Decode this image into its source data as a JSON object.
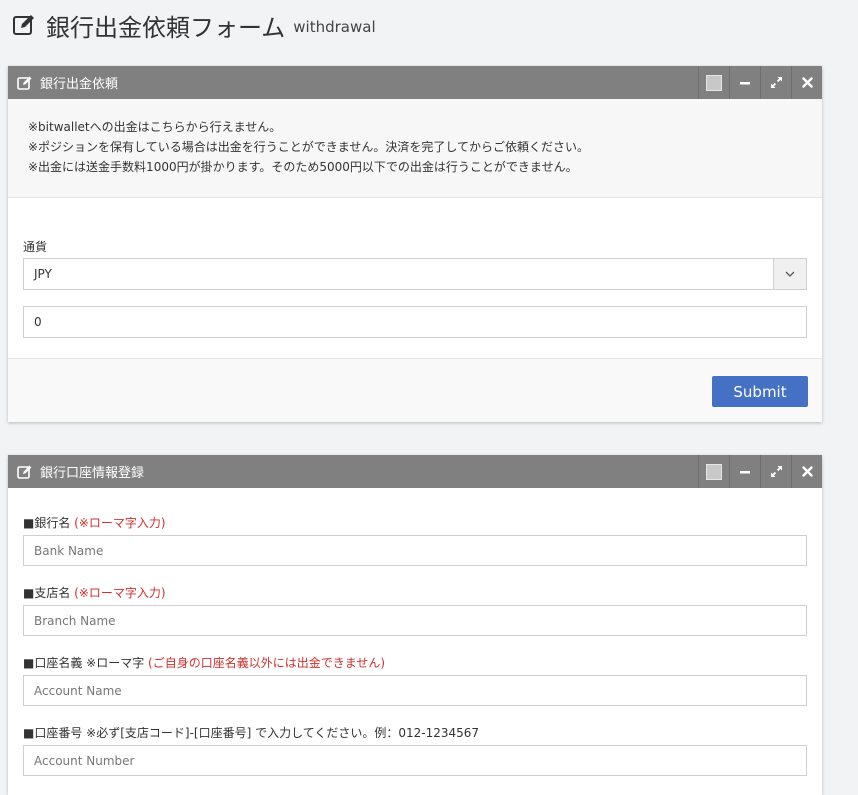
{
  "page": {
    "title": "銀行出金依頼フォーム",
    "subtitle": "withdrawal",
    "header_icon": "edit-icon"
  },
  "withdrawal_panel": {
    "title": "銀行出金依頼",
    "icon": "edit-icon",
    "notices": [
      "※bitwalletへの出金はこちらから行えません。",
      "※ポジションを保有している場合は出金を行うことができません。決済を完了してからご依頼ください。",
      "※出金には送金手数料1000円が掛かります。そのため5000円以下での出金は行うことができません。"
    ],
    "currency_label": "通貨",
    "currency_value": "JPY",
    "amount_value": "0",
    "submit_label": "Submit"
  },
  "bank_panel": {
    "title": "銀行口座情報登録",
    "icon": "edit-icon",
    "bank_name_label": "■銀行名",
    "bank_name_note": "(※ローマ字入力)",
    "bank_name_placeholder": "Bank Name",
    "branch_name_label": "■支店名",
    "branch_name_note": "(※ローマ字入力)",
    "branch_name_placeholder": "Branch Name",
    "account_name_label": "■口座名義 ※ローマ字",
    "account_name_note": "(ご自身の口座名義以外には出金できません)",
    "account_name_placeholder": "Account Name",
    "account_number_label": "■口座番号 ※必ず[支店コード]-[口座番号] で入力してください。例：012-1234567",
    "account_number_placeholder": "Account Number"
  },
  "colors": {
    "panel_header": "#808080",
    "accent": "#4571c4",
    "note_red": "#d0312d",
    "background": "#f2f3f5"
  }
}
